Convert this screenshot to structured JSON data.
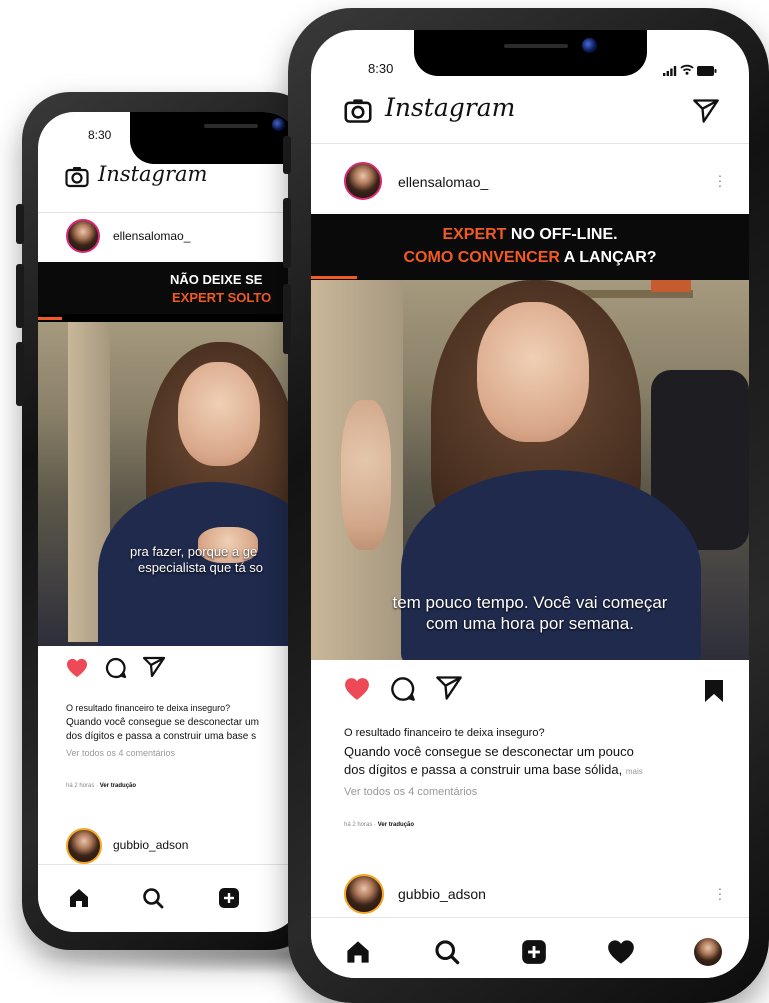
{
  "status_bar": {
    "time": "8:30"
  },
  "app": {
    "name": "Instagram"
  },
  "back_phone": {
    "post": {
      "username": "ellensalomao_",
      "video_headline_line1": "NÃO DEIXE SE",
      "video_headline_line2": "EXPERT SOLTO",
      "subtitle_line1": "pra fazer, porque a ge",
      "subtitle_line2": "especialista que tá so",
      "caption_line1": "O resultado financeiro te deixa inseguro?",
      "caption_line2": "Quando você consegue se desconectar um",
      "caption_line3": "dos dígitos e passa a construir uma base s",
      "view_comments": "Ver todos os 4 comentários",
      "time_ago": "há 2 horas",
      "separator": "·",
      "translate": "Ver tradução"
    },
    "next_post": {
      "username": "gubbio_adson"
    }
  },
  "front_phone": {
    "post": {
      "username": "ellensalomao_",
      "video_headline_line1_orange": "EXPERT",
      "video_headline_line1_white": " NO OFF-LINE.",
      "video_headline_line2_orange": "COMO CONVENCER",
      "video_headline_line2_white": " A LANÇAR?",
      "subtitle_line1": "tem pouco tempo. Você vai começar",
      "subtitle_line2": "com uma hora por semana.",
      "caption_line1": "O resultado financeiro te deixa inseguro?",
      "caption_line2": "Quando você consegue se desconectar um pouco",
      "caption_line3": "dos dígitos e passa a construir uma base sólida,",
      "more": "mais",
      "view_comments": "Ver todos os 4 comentários",
      "time_ago": "há 2 horas",
      "separator": "·",
      "translate": "Ver tradução"
    },
    "next_post": {
      "username": "gubbio_adson"
    }
  },
  "colors": {
    "accent_orange": "#f15a22",
    "like_red": "#ed4956",
    "story_ring": "#d62976"
  },
  "icons": [
    "camera-icon",
    "send-icon",
    "heart-icon",
    "comment-icon",
    "bookmark-icon",
    "more-icon",
    "home-icon",
    "search-icon",
    "add-icon",
    "activity-heart-icon",
    "profile-avatar"
  ]
}
